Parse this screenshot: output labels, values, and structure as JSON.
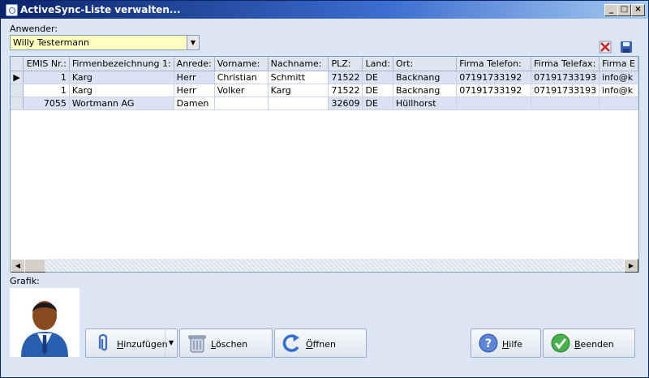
{
  "window": {
    "title": "ActiveSync-Liste verwalten..."
  },
  "user": {
    "label": "Anwender:",
    "selected": "Willy Testermann"
  },
  "grid": {
    "columns": [
      "EMIS Nr.:",
      "Firmenbezeichnung 1:",
      "Anrede:",
      "Vorname:",
      "Nachname:",
      "PLZ:",
      "Land:",
      "Ort:",
      "Firma Telefon:",
      "Firma Telefax:",
      "Firma E"
    ],
    "rows": [
      [
        "1",
        "Karg",
        "Herr",
        "Christian",
        "Schmitt",
        "71522",
        "DE",
        "Backnang",
        "07191733192",
        "07191733193",
        "info@k"
      ],
      [
        "1",
        "Karg",
        "Herr",
        "Volker",
        "Karg",
        "71522",
        "DE",
        "Backnang",
        "07191733192",
        "07191733193",
        "info@k"
      ],
      [
        "7055",
        "Wortmann AG",
        "Damen",
        "",
        "",
        "32609",
        "DE",
        "Hüllhorst",
        "",
        "",
        ""
      ]
    ]
  },
  "graphic": {
    "label": "Grafik:"
  },
  "buttons": {
    "add": "Hinzufügen",
    "delete": "Löschen",
    "open": "Öffnen",
    "help": "Hilfe",
    "exit": "Beenden"
  },
  "icons": {
    "delete_tool": "delete-x-icon",
    "save_tool": "floppy-disk-icon"
  },
  "colors": {
    "accent": "#0a246a",
    "combo_bg": "#ffffc0",
    "row_highlight": "#d9e3f4"
  }
}
